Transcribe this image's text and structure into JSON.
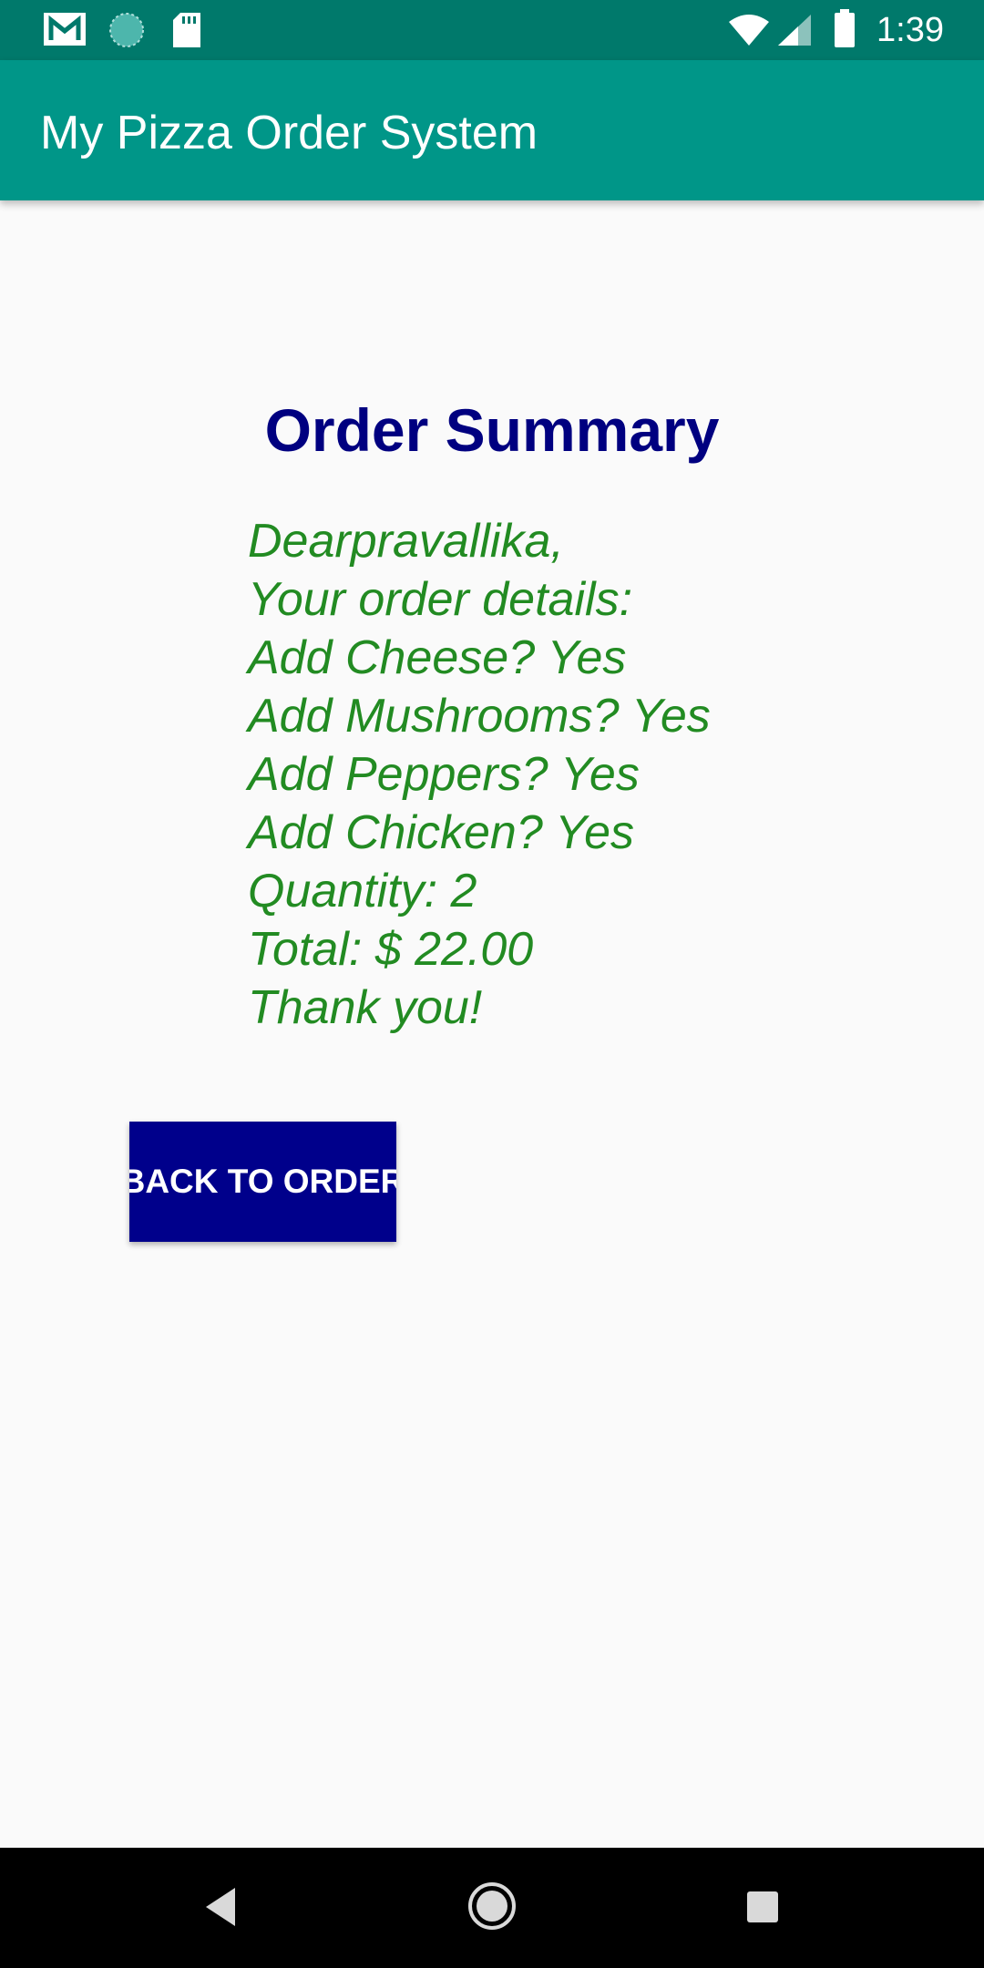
{
  "status_bar": {
    "time": "1:39",
    "left_icons": [
      "gmail-icon",
      "sync-icon",
      "sd-card-icon"
    ],
    "right_icons": [
      "wifi-icon",
      "signal-icon",
      "battery-icon"
    ]
  },
  "app_bar": {
    "title": "My Pizza Order System"
  },
  "main": {
    "heading": "Order Summary",
    "summary_lines": [
      "Dearpravallika,",
      "Your order details:",
      "Add Cheese? Yes",
      "Add Mushrooms? Yes",
      "Add Peppers? Yes",
      "Add Chicken? Yes",
      "Quantity: 2",
      "Total: $ 22.00",
      "Thank you!"
    ],
    "back_button_label": "BACK TO ORDER"
  },
  "nav_bar": {
    "buttons": [
      "back-icon",
      "home-icon",
      "recents-icon"
    ]
  },
  "colors": {
    "status_bar": "#00796b",
    "app_bar": "#009688",
    "heading": "#000080",
    "summary_text": "#228b22",
    "button": "#00008b"
  }
}
